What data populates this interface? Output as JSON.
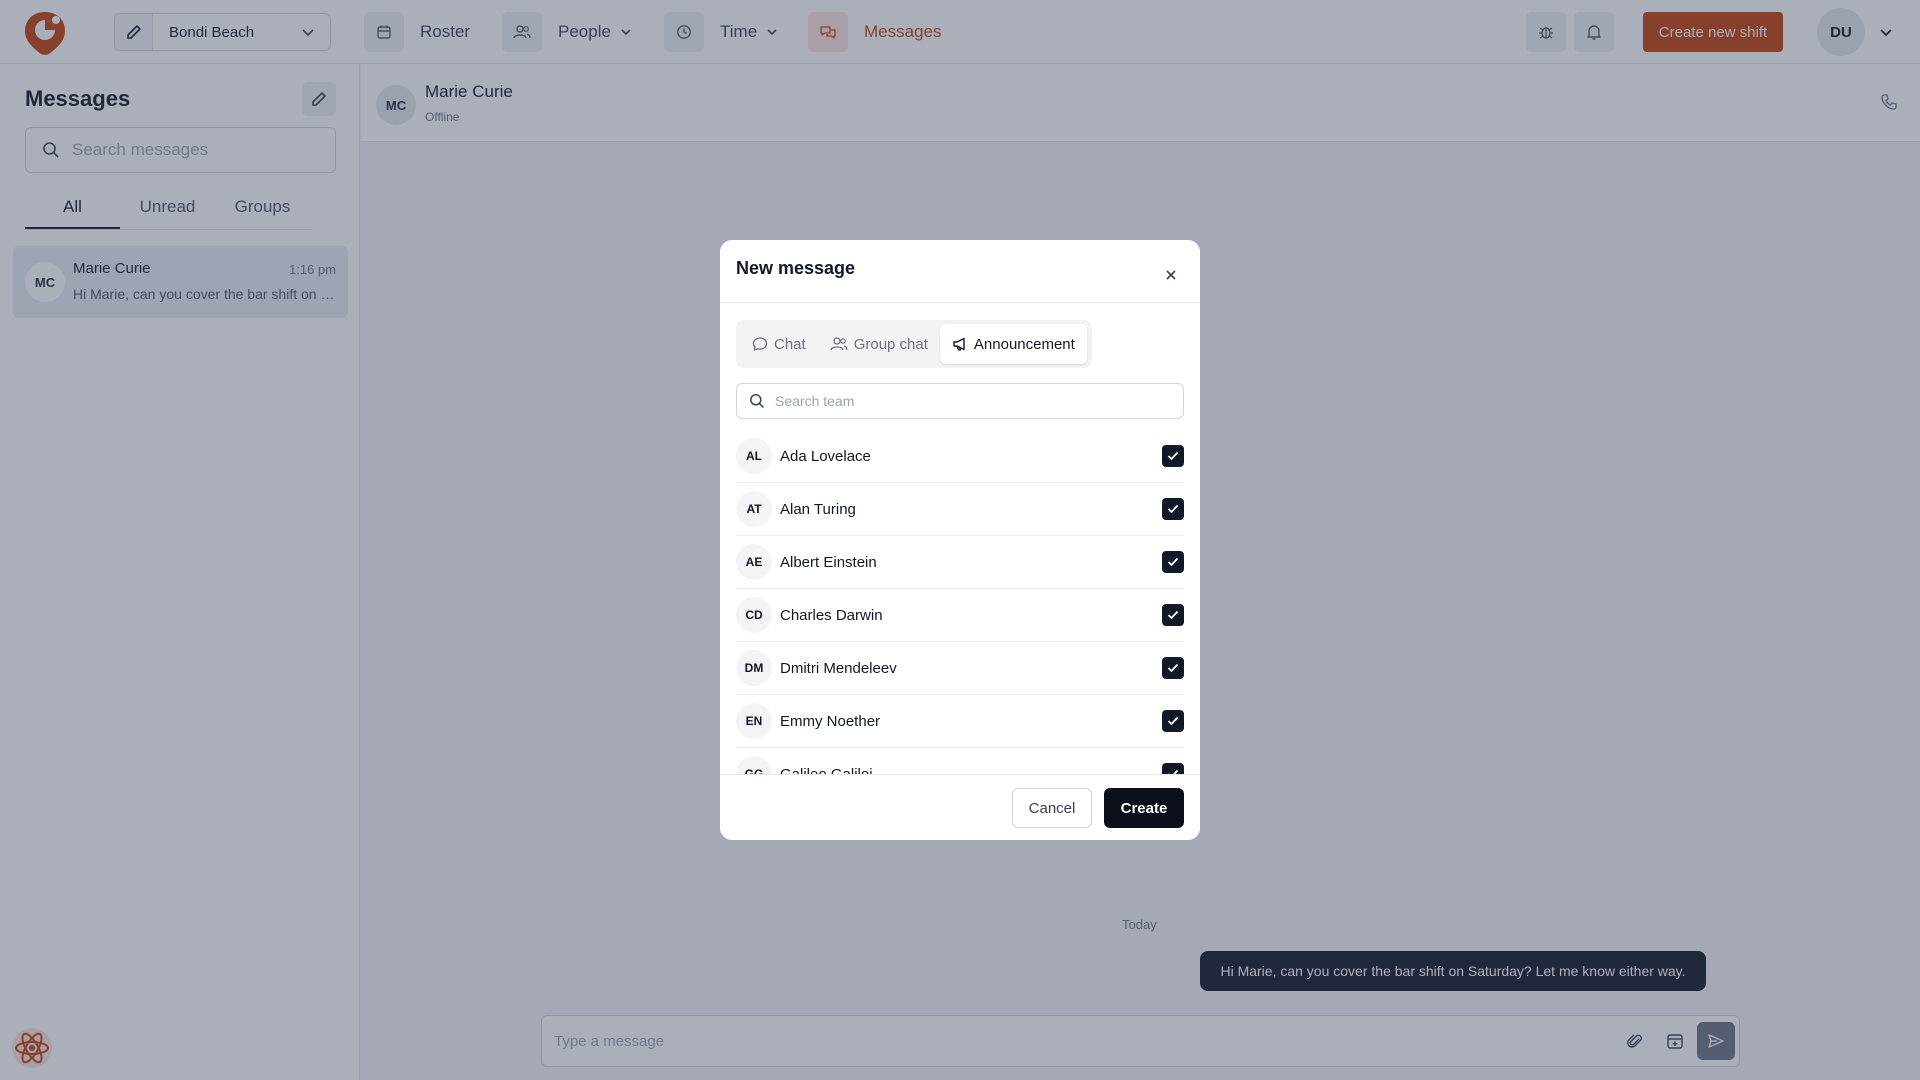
{
  "topbar": {
    "location": "Bondi Beach",
    "nav": {
      "roster": "Roster",
      "people": "People",
      "time": "Time",
      "messages": "Messages"
    },
    "create_shift": "Create new shift",
    "user_initials": "DU"
  },
  "sidebar": {
    "title": "Messages",
    "search_placeholder": "Search messages",
    "tabs": [
      "All",
      "Unread",
      "Groups"
    ],
    "conversations": [
      {
        "initials": "MC",
        "name": "Marie Curie",
        "time": "1:16 pm",
        "preview": "Hi Marie, can you cover the bar shift on Saturday? Let me know either way."
      }
    ]
  },
  "chat": {
    "initials": "MC",
    "name": "Marie Curie",
    "status": "Offline",
    "day_label": "Today",
    "messages": [
      {
        "text": "Hi Marie, can you cover the bar shift on Saturday? Let me know either way."
      }
    ],
    "composer_placeholder": "Type a message"
  },
  "modal": {
    "title": "New message",
    "types": [
      "Chat",
      "Group chat",
      "Announcement"
    ],
    "active_type": "Announcement",
    "search_placeholder": "Search team",
    "members": [
      {
        "initials": "AL",
        "name": "Ada Lovelace",
        "checked": true
      },
      {
        "initials": "AT",
        "name": "Alan Turing",
        "checked": true
      },
      {
        "initials": "AE",
        "name": "Albert Einstein",
        "checked": true
      },
      {
        "initials": "CD",
        "name": "Charles Darwin",
        "checked": true
      },
      {
        "initials": "DM",
        "name": "Dmitri Mendeleev",
        "checked": true
      },
      {
        "initials": "EN",
        "name": "Emmy Noether",
        "checked": true
      },
      {
        "initials": "GG",
        "name": "Galileo Galilei",
        "checked": true
      }
    ],
    "cancel": "Cancel",
    "create": "Create"
  },
  "colors": {
    "brand": "#c2410c",
    "dark": "#111827"
  }
}
